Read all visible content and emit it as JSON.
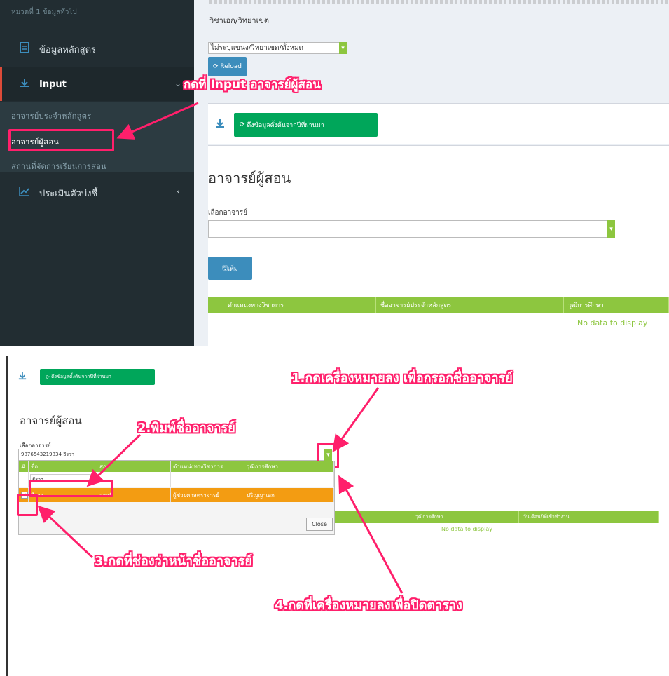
{
  "top": {
    "sidebar": {
      "header": "หมวดที่ 1 ข้อมูลทั่วไป",
      "item_course": "ข้อมูลหลักสูตร",
      "item_input": "Input",
      "sub_items": [
        "อาจารย์ประจำหลักสูตร",
        "อาจารย์ผู้สอน",
        "สถานที่จัดการเรียนการสอน"
      ],
      "item_eval": "ประเมินตัวบ่งชี้"
    },
    "content": {
      "major_label": "วิชาเอก/วิทยาเขต",
      "major_select_value": "ไม่ระบุแขนง/วิทยาเขต/ทั้งหมด",
      "reload_label": "Reload",
      "pull_button": "ดึงข้อมูลตั้งต้นจากปีที่ผ่านมา",
      "section_title": "อาจารย์ผู้สอน",
      "select_label": "เลือกอาจารย์",
      "add_button": "เพิ่ม",
      "table_headers": [
        "ตำแหน่งทางวิชาการ",
        "ชื่ออาจารย์ประจำหลักสูตร",
        "วุฒิการศึกษา"
      ],
      "no_data": "No data to display"
    },
    "annotation": "กดที่ Input อาจารย์ผู้สอน"
  },
  "bottom": {
    "pull_button": "ดึงข้อมูลตั้งต้นจากปีที่ผ่านมา",
    "section_title": "อาจารย์ผู้สอน",
    "select_label": "เลือกอาจารย์",
    "select_value": "9876543219834 ธีรวา",
    "grid_headers": [
      "#",
      "ชื่อ",
      "สกุล",
      "ตำแหน่งทางวิชาการ",
      "วุฒิการศึกษา"
    ],
    "search_value": "ธีรวา",
    "result_row": [
      "ธีรวา",
      "อาจดี",
      "ผู้ช่วยศาสตราจารย์",
      "ปริญญาเอก"
    ],
    "close_button": "Close",
    "behind_headers": [
      "วุฒิการศึกษา",
      "วันเดือนปีที่เข้าทำงาน"
    ],
    "no_data": "No data to display"
  },
  "annotations": {
    "step1": "1.กดเครื่องหมายลง เพื่อกรอกชื่ออาจารย์",
    "step2": "2.พิมพ์ชื่ออาจารย์",
    "step3": "3.กดที่ช่องว่าหน้าชื่ออาจารย์",
    "step4": "4.กดที่เครื่องหมายลงเพื่อปิดตาราง"
  },
  "colors": {
    "annotation": "#ff1f6b",
    "green": "#00a65a",
    "table_green": "#8dc63f",
    "blue": "#3c8dbc",
    "orange": "#f39c12",
    "sidebar": "#222d32"
  }
}
